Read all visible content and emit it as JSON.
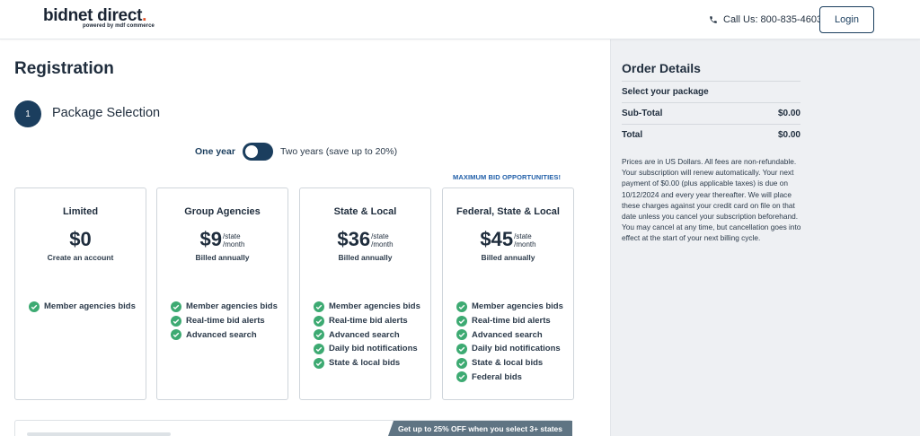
{
  "header": {
    "logo_main": "bidnet direct",
    "logo_dot": ".",
    "logo_sub": "powered by mdf commerce",
    "call_label": "Call Us: 800-835-4603",
    "login_label": "Login"
  },
  "main": {
    "title": "Registration",
    "step_number": "1",
    "step_title": "Package Selection",
    "toggle": {
      "left_label": "One year",
      "right_label": "Two years (save up to 20%)",
      "selected": "One year"
    },
    "max_label": "MAXIMUM BID OPPORTUNITIES!",
    "packages": [
      {
        "name": "Limited",
        "price": "$0",
        "per_line1": "",
        "per_line2": "",
        "billed": "Create an account",
        "features": [
          "Member agencies bids"
        ]
      },
      {
        "name": "Group Agencies",
        "price": "$9",
        "per_line1": "/state",
        "per_line2": "/month",
        "billed": "Billed annually",
        "features": [
          "Member agencies bids",
          "Real-time bid alerts",
          "Advanced search"
        ]
      },
      {
        "name": "State & Local",
        "price": "$36",
        "per_line1": "/state",
        "per_line2": "/month",
        "billed": "Billed annually",
        "features": [
          "Member agencies bids",
          "Real-time bid alerts",
          "Advanced search",
          "Daily bid notifications",
          "State & local bids"
        ]
      },
      {
        "name": "Federal, State & Local",
        "price": "$45",
        "per_line1": "/state",
        "per_line2": "/month",
        "billed": "Billed annually",
        "features": [
          "Member agencies bids",
          "Real-time bid alerts",
          "Advanced search",
          "Daily bid notifications",
          "State & local bids",
          "Federal bids"
        ]
      }
    ],
    "promo": "Get up to 25% OFF when you select 3+ states"
  },
  "order": {
    "title": "Order Details",
    "select_label": "Select your package",
    "subtotal_label": "Sub-Total",
    "subtotal_value": "$0.00",
    "total_label": "Total",
    "total_value": "$0.00",
    "note": "Prices are in US Dollars. All fees are non-refundable. Your subscription will renew automatically. Your next payment of $0.00 (plus applicable taxes) is due on 10/12/2024 and every year thereafter. We will place these charges against your credit card on file on that date unless you cancel your subscription beforehand. You may cancel at any time, but cancellation goes into effect at the start of your next billing cycle."
  },
  "colors": {
    "primary": "#1b3e5e",
    "accent_dot": "#e4572e",
    "check": "#3daa72",
    "link_blue": "#1f5ea8",
    "panel_bg": "#eef0f3",
    "promo_bg": "#5f7483"
  },
  "icons": {
    "phone": "phone-icon",
    "check": "check-circle-icon"
  }
}
